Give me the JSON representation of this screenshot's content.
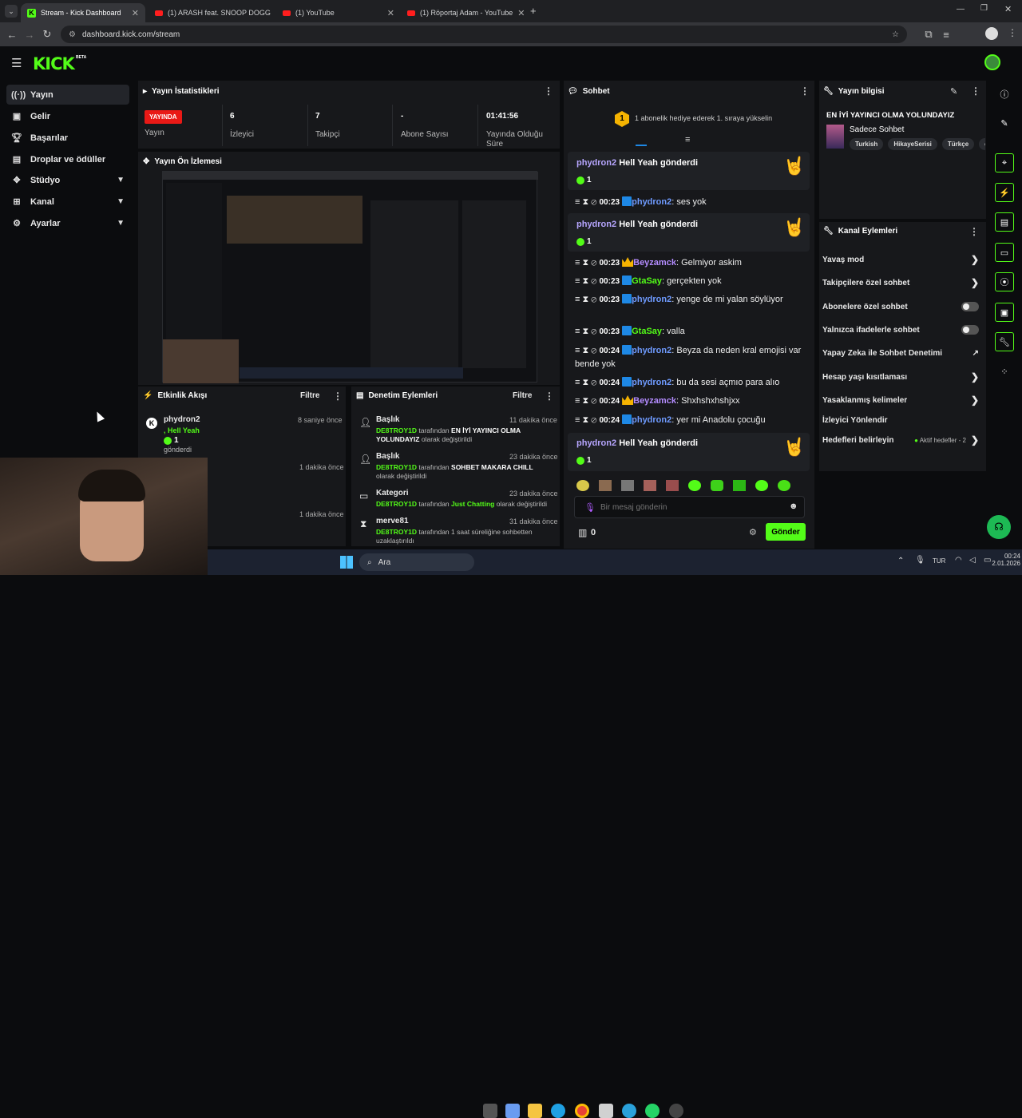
{
  "browser": {
    "tabs": [
      {
        "title": "Stream - Kick Dashboard",
        "active": true
      },
      {
        "title": "(1) ARASH feat. SNOOP DOGG",
        "active": false
      },
      {
        "title": "(1) YouTube",
        "active": false
      },
      {
        "title": "(1) Röportaj Adam - YouTube",
        "active": false
      }
    ],
    "url": "dashboard.kick.com/stream"
  },
  "header": {
    "logo": "KICK",
    "beta": "BETA"
  },
  "sidebar": {
    "items": [
      {
        "label": "Yayın",
        "icon": "broadcast-icon"
      },
      {
        "label": "Gelir",
        "icon": "wallet-icon"
      },
      {
        "label": "Başarılar",
        "icon": "trophy-icon"
      },
      {
        "label": "Droplar ve ödüller",
        "icon": "gift-icon"
      },
      {
        "label": "Stüdyo",
        "icon": "studio-icon"
      },
      {
        "label": "Kanal",
        "icon": "channel-icon"
      },
      {
        "label": "Ayarlar",
        "icon": "gear-icon"
      }
    ]
  },
  "stats": {
    "title": "Yayın İstatistikleri",
    "live_badge": "YAYINDA",
    "live_label": "Yayın",
    "viewers_value": "6",
    "viewers_label": "İzleyici",
    "followers_value": "7",
    "followers_label": "Takipçi",
    "subs_value": "-",
    "subs_label": "Abone Sayısı",
    "uptime_value": "01:41:56",
    "uptime_label": "Yayında Olduğu Süre"
  },
  "preview": {
    "title": "Yayın Ön İzlemesi"
  },
  "activity": {
    "title": "Etkinlik Akışı",
    "filter": "Filtre",
    "items": [
      {
        "user": "phydron2",
        "time": "8 saniye önce",
        "line1": ", Hell Yeah",
        "count": "1",
        "line2": "gönderdi"
      },
      {
        "time": "1 dakika önce"
      },
      {
        "time": "1 dakika önce"
      }
    ]
  },
  "moderation": {
    "title": "Denetim Eylemleri",
    "filter": "Filtre",
    "items": [
      {
        "kind": "Başlık",
        "time": "11 dakika önce",
        "actor": "DE8TROY1D",
        "mid": " tarafından ",
        "target": "EN İYİ YAYINCI OLMA YOLUNDAYIZ",
        "end": " olarak değiştirildi"
      },
      {
        "kind": "Başlık",
        "time": "23 dakika önce",
        "actor": "DE8TROY1D",
        "mid": " tarafından ",
        "target": "SOHBET MAKARA CHILL",
        "end": " olarak değiştirildi"
      },
      {
        "kind": "Kategori",
        "time": "23 dakika önce",
        "actor": "DE8TROY1D",
        "mid": " tarafından ",
        "target": "Just Chatting",
        "end": " olarak değiştirildi"
      },
      {
        "kind": "merve81",
        "time": "31 dakika önce",
        "actor": "DE8TROY1D",
        "mid": " tarafından 1 saat süreliğine sohbetten uzaklaştırıldı",
        "target": "",
        "end": ""
      }
    ]
  },
  "chat": {
    "title": "Sohbet",
    "sub_goal_count": "1",
    "sub_goal_text": "1 abonelik hediye ederek 1. sıraya yükselin",
    "gift_user": "phydron2",
    "gift_text": "Hell Yeah gönderdi",
    "gift_count": "1",
    "messages": [
      {
        "time": "00:23",
        "user": "phydron2",
        "badge": "blue",
        "color": "#6f9bff",
        "text": "ses yok"
      },
      {
        "time": "00:23",
        "user": "Beyzamck",
        "badge": "crown",
        "color": "#b48cff",
        "text": "Gelmiyor askim"
      },
      {
        "time": "00:23",
        "user": "GtaSay",
        "badge": "blue",
        "color": "#53fc18",
        "text": "gerçekten yok"
      },
      {
        "time": "00:23",
        "user": "phydron2",
        "badge": "blue",
        "color": "#6f9bff",
        "text": "yenge de mi yalan söylüyor"
      },
      {
        "time": "00:23",
        "user": "GtaSay",
        "badge": "blue",
        "color": "#53fc18",
        "text": "valla"
      },
      {
        "time": "00:24",
        "user": "phydron2",
        "badge": "blue",
        "color": "#6f9bff",
        "text": "Beyza da neden kral emojisi var bende yok"
      },
      {
        "time": "00:24",
        "user": "phydron2",
        "badge": "blue",
        "color": "#6f9bff",
        "text": "bu da sesi açmıo para alıo"
      },
      {
        "time": "00:24",
        "user": "Beyzamck",
        "badge": "crown",
        "color": "#b48cff",
        "text": "Shxhshxhshjxx"
      },
      {
        "time": "00:24",
        "user": "phydron2",
        "badge": "blue",
        "color": "#6f9bff",
        "text": "yer mi Anadolu çocuğu"
      }
    ],
    "input_placeholder": "Bir mesaj gönderin",
    "points": "0",
    "send_label": "Gönder"
  },
  "stream_info": {
    "title": "Yayın bilgisi",
    "stream_title": "EN İYİ YAYINCI OLMA YOLUNDAYIZ",
    "category": "Sadece Sohbet",
    "tags": [
      "Turkish",
      "HikayeSerisi",
      "Türkçe",
      "c"
    ]
  },
  "channel_actions": {
    "title": "Kanal Eylemleri",
    "items": [
      {
        "label": "Yavaş mod",
        "control": "arrow"
      },
      {
        "label": "Takipçilere özel sohbet",
        "control": "arrow"
      },
      {
        "label": "Abonelere özel sohbet",
        "control": "toggle"
      },
      {
        "label": "Yalnızca ifadelerle sohbet",
        "control": "toggle"
      },
      {
        "label": "Yapay Zeka ile Sohbet Denetimi",
        "control": "external"
      },
      {
        "label": "Hesap yaşı kısıtlaması",
        "control": "arrow"
      },
      {
        "label": "Yasaklanmış kelimeler",
        "control": "arrow"
      },
      {
        "label": "İzleyici Yönlendir",
        "control": "none"
      },
      {
        "label": "Hedefleri belirleyin",
        "control": "arrow"
      }
    ],
    "goals_status": "Aktif hedefler - 2"
  },
  "taskbar": {
    "search": "Ara",
    "lang": "TUR",
    "time": "00:24",
    "date": "2.01.2026"
  },
  "colors": {
    "accent": "#53fc18",
    "live": "#e91916",
    "panel": "#17181b",
    "bg": "#0b0c0e"
  }
}
